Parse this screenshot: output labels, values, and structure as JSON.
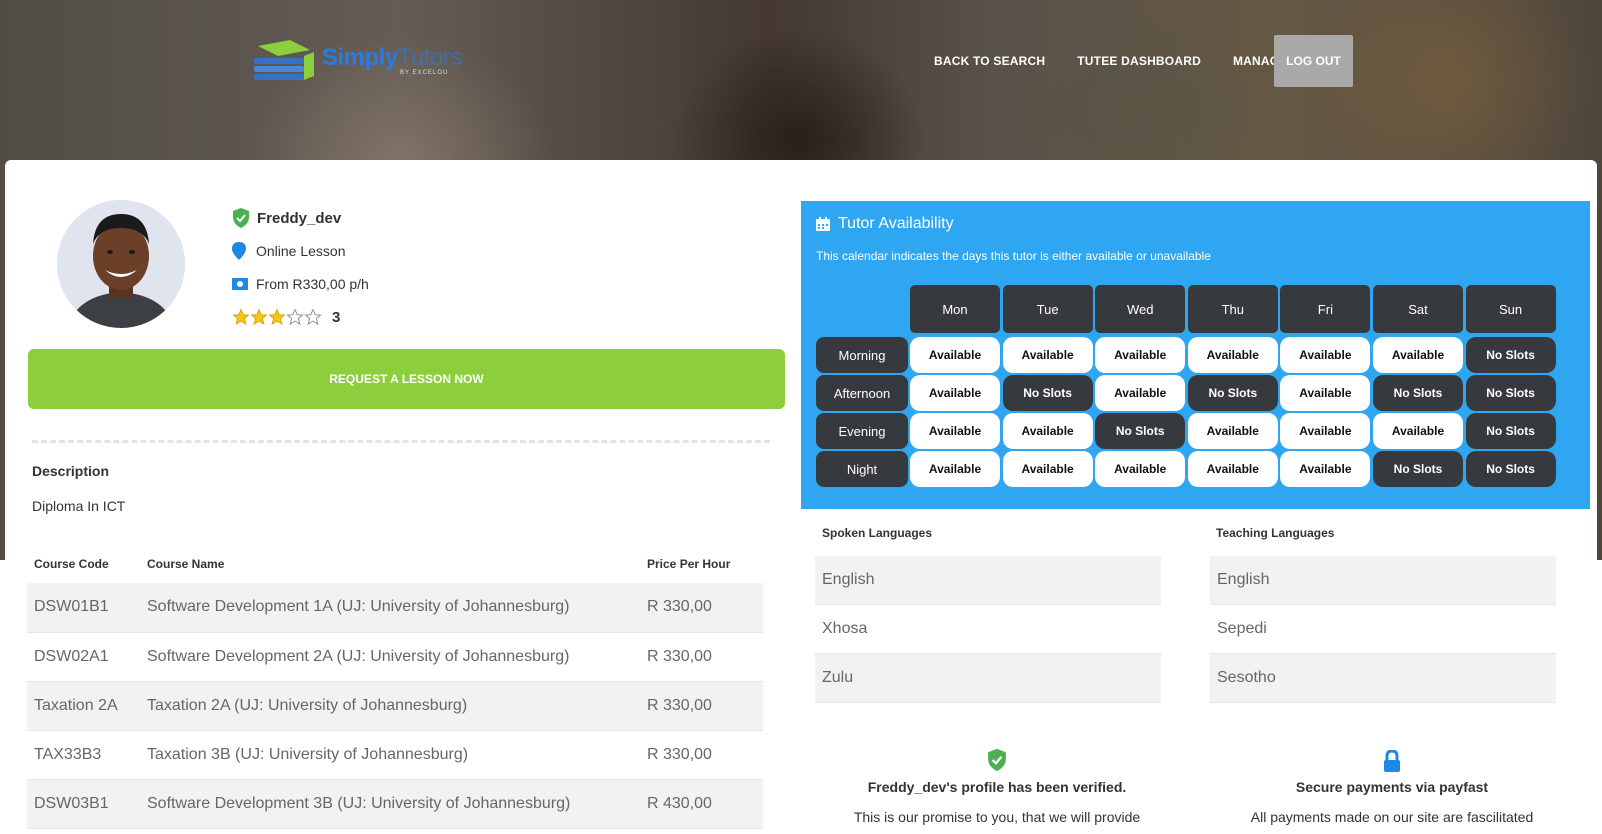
{
  "brand": {
    "name_part1": "Simply",
    "name_part2": "Tutors",
    "tagline": "BY EXCELOU"
  },
  "nav": {
    "items": [
      "BACK TO SEARCH",
      "TUTEE DASHBOARD",
      "MANAGE"
    ],
    "logout": "LOG OUT"
  },
  "profile": {
    "name": "Freddy_dev",
    "lesson_type": "Online Lesson",
    "price": "From R330,00 p/h",
    "rating": 3,
    "rating_max": 5,
    "rating_label": "3"
  },
  "request_button": "REQUEST A LESSON NOW",
  "description": {
    "title": "Description",
    "text": "Diploma In ICT"
  },
  "courses": {
    "headers": [
      "Course Code",
      "Course Name",
      "Price Per Hour"
    ],
    "rows": [
      [
        "DSW01B1",
        "Software Development 1A (UJ: University of Johannesburg)",
        "R 330,00"
      ],
      [
        "DSW02A1",
        "Software Development 2A (UJ: University of Johannesburg)",
        "R 330,00"
      ],
      [
        "Taxation 2A",
        "Taxation 2A (UJ: University of Johannesburg)",
        "R 330,00"
      ],
      [
        "TAX33B3",
        "Taxation 3B (UJ: University of Johannesburg)",
        "R 330,00"
      ],
      [
        "DSW03B1",
        "Software Development 3B (UJ: University of Johannesburg)",
        "R 430,00"
      ]
    ]
  },
  "availability": {
    "title": "Tutor Availability",
    "subtitle": "This calendar indicates the days this tutor is either available or unavailable",
    "days": [
      "Mon",
      "Tue",
      "Wed",
      "Thu",
      "Fri",
      "Sat",
      "Sun"
    ],
    "slots": [
      {
        "label": "Morning",
        "cells": [
          "Available",
          "Available",
          "Available",
          "Available",
          "Available",
          "Available",
          "No Slots"
        ]
      },
      {
        "label": "Afternoon",
        "cells": [
          "Available",
          "No Slots",
          "Available",
          "No Slots",
          "Available",
          "No Slots",
          "No Slots"
        ]
      },
      {
        "label": "Evening",
        "cells": [
          "Available",
          "Available",
          "No Slots",
          "Available",
          "Available",
          "Available",
          "No Slots"
        ]
      },
      {
        "label": "Night",
        "cells": [
          "Available",
          "Available",
          "Available",
          "Available",
          "Available",
          "No Slots",
          "No Slots"
        ]
      }
    ]
  },
  "languages": {
    "spoken_title": "Spoken Languages",
    "spoken": [
      "English",
      "Xhosa",
      "Zulu"
    ],
    "teaching_title": "Teaching Languages",
    "teaching": [
      "English",
      "Sepedi",
      "Sesotho"
    ]
  },
  "trust": {
    "verified_title": "Freddy_dev's profile has been verified.",
    "verified_text": "This is our promise to you, that we will provide",
    "secure_title": "Secure payments via payfast",
    "secure_text": "All payments made on our site are fascilitated"
  },
  "colors": {
    "accent_green": "#8dce3c",
    "availability_blue": "#2ea6f2",
    "slot_dark": "#363a3e",
    "verified_green": "#4caf50",
    "lock_blue": "#1e88e5",
    "star_gold": "#f5c518"
  },
  "icons": [
    "verified-shield-icon",
    "location-pin-icon",
    "money-icon",
    "star-icon",
    "calendar-icon",
    "lock-icon"
  ]
}
